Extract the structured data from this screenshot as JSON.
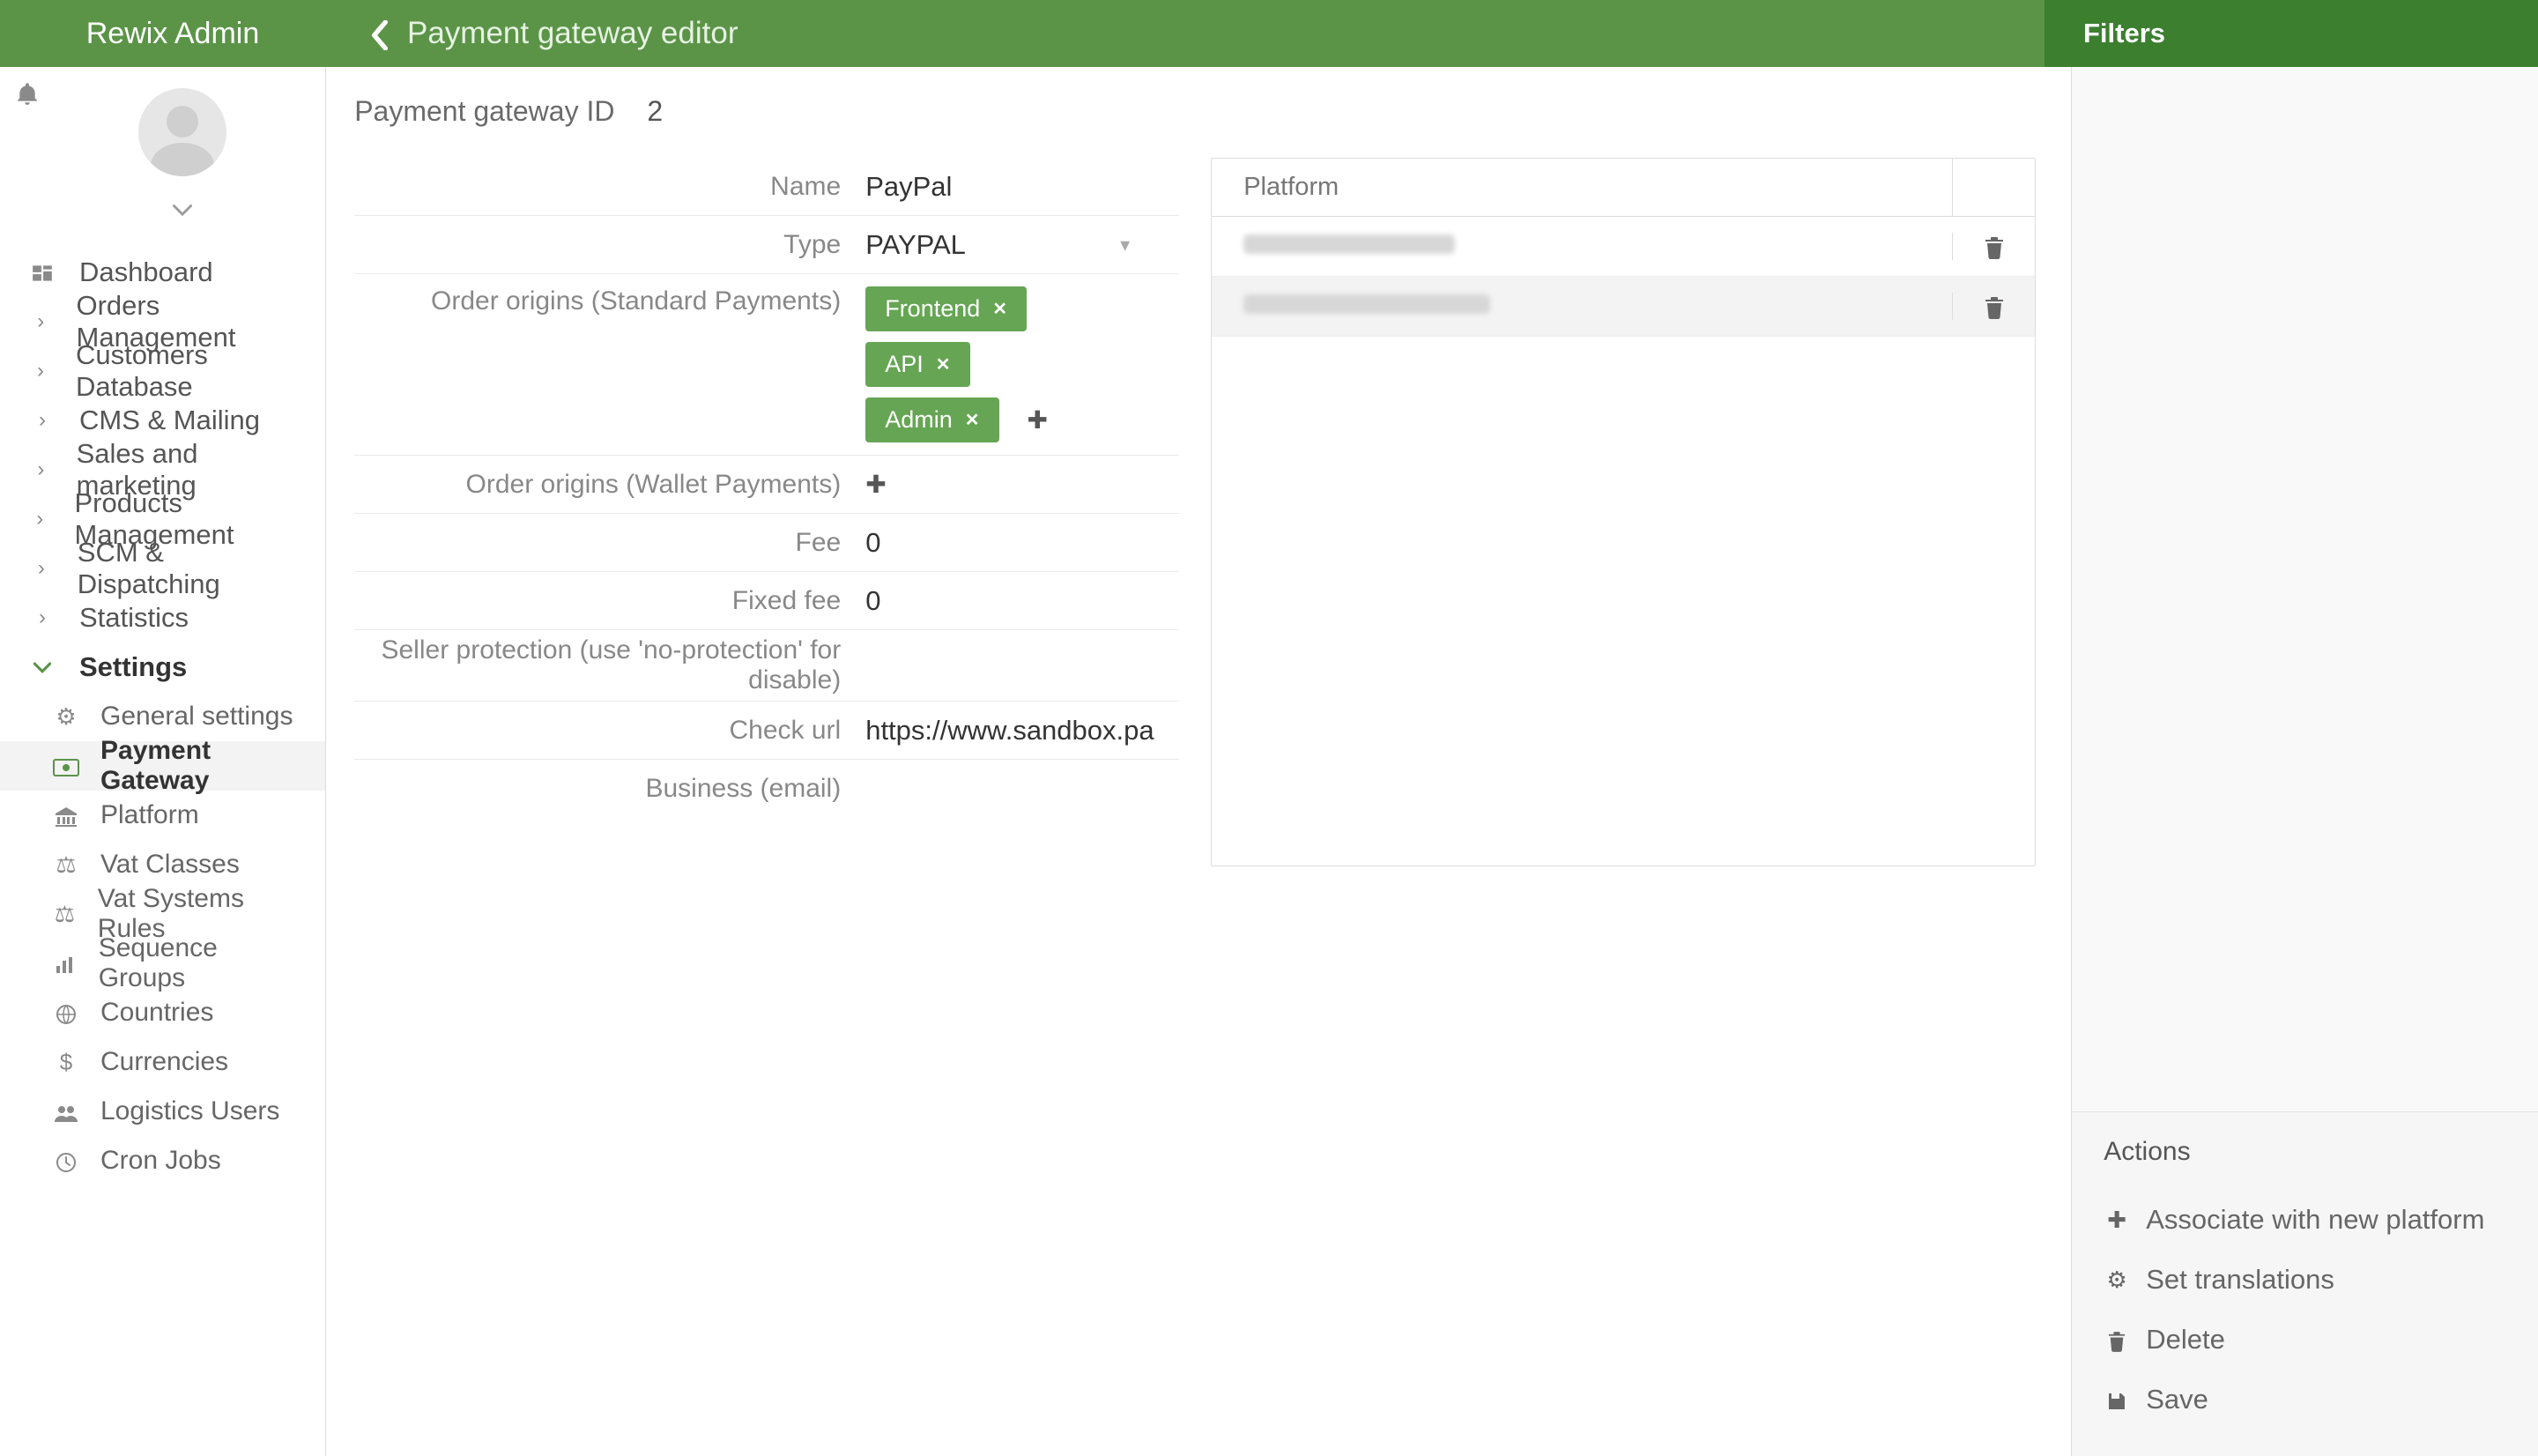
{
  "topbar": {
    "brand": "Rewix Admin",
    "title": "Payment gateway editor",
    "filters_label": "Filters"
  },
  "sidebar": {
    "items": [
      {
        "label": "Dashboard",
        "icon": "dashboard"
      },
      {
        "label": "Orders Management",
        "icon": "chevron"
      },
      {
        "label": "Customers Database",
        "icon": "chevron"
      },
      {
        "label": "CMS & Mailing",
        "icon": "chevron"
      },
      {
        "label": "Sales and marketing",
        "icon": "chevron"
      },
      {
        "label": "Products Management",
        "icon": "chevron"
      },
      {
        "label": "SCM & Dispatching",
        "icon": "chevron"
      },
      {
        "label": "Statistics",
        "icon": "chevron"
      },
      {
        "label": "Settings",
        "icon": "chevron-down",
        "expanded": true
      }
    ],
    "settings_children": [
      {
        "label": "General settings",
        "icon": "cogs"
      },
      {
        "label": "Payment Gateway",
        "icon": "money",
        "active": true
      },
      {
        "label": "Platform",
        "icon": "bank"
      },
      {
        "label": "Vat Classes",
        "icon": "scale"
      },
      {
        "label": "Vat Systems Rules",
        "icon": "scale"
      },
      {
        "label": "Sequence Groups",
        "icon": "bars"
      },
      {
        "label": "Countries",
        "icon": "globe"
      },
      {
        "label": "Currencies",
        "icon": "dollar"
      },
      {
        "label": "Logistics Users",
        "icon": "users"
      },
      {
        "label": "Cron Jobs",
        "icon": "clock"
      }
    ]
  },
  "gateway": {
    "id_label": "Payment gateway ID",
    "id_value": "2",
    "fields": {
      "name_label": "Name",
      "name_value": "PayPal",
      "type_label": "Type",
      "type_value": "PAYPAL",
      "origins_std_label": "Order origins (Standard Payments)",
      "origins_std_tags": [
        "Frontend",
        "API",
        "Admin"
      ],
      "origins_wallet_label": "Order origins (Wallet Payments)",
      "fee_label": "Fee",
      "fee_value": "0",
      "fixed_fee_label": "Fixed fee",
      "fixed_fee_value": "0",
      "seller_protection_label": "Seller protection (use 'no-protection' for disable)",
      "seller_protection_value": "",
      "check_url_label": "Check url",
      "check_url_value": "https://www.sandbox.pa",
      "business_email_label": "Business (email)",
      "business_email_value": ""
    }
  },
  "platform_table": {
    "header": "Platform"
  },
  "actions_panel": {
    "title": "Actions",
    "items": [
      {
        "label": "Associate with new platform",
        "icon": "plus"
      },
      {
        "label": "Set translations",
        "icon": "cogs"
      },
      {
        "label": "Delete",
        "icon": "trash"
      },
      {
        "label": "Save",
        "icon": "save"
      }
    ]
  }
}
